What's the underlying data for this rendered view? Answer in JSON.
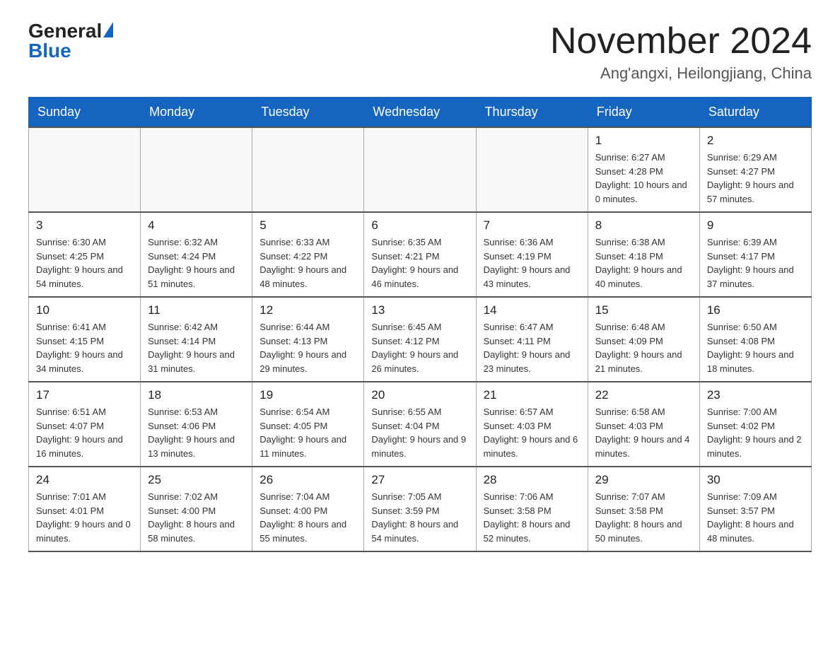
{
  "logo": {
    "general": "General",
    "blue": "Blue"
  },
  "title": "November 2024",
  "location": "Ang'angxi, Heilongjiang, China",
  "days_header": [
    "Sunday",
    "Monday",
    "Tuesday",
    "Wednesday",
    "Thursday",
    "Friday",
    "Saturday"
  ],
  "weeks": [
    [
      {
        "day": "",
        "info": ""
      },
      {
        "day": "",
        "info": ""
      },
      {
        "day": "",
        "info": ""
      },
      {
        "day": "",
        "info": ""
      },
      {
        "day": "",
        "info": ""
      },
      {
        "day": "1",
        "info": "Sunrise: 6:27 AM\nSunset: 4:28 PM\nDaylight: 10 hours and 0 minutes."
      },
      {
        "day": "2",
        "info": "Sunrise: 6:29 AM\nSunset: 4:27 PM\nDaylight: 9 hours and 57 minutes."
      }
    ],
    [
      {
        "day": "3",
        "info": "Sunrise: 6:30 AM\nSunset: 4:25 PM\nDaylight: 9 hours and 54 minutes."
      },
      {
        "day": "4",
        "info": "Sunrise: 6:32 AM\nSunset: 4:24 PM\nDaylight: 9 hours and 51 minutes."
      },
      {
        "day": "5",
        "info": "Sunrise: 6:33 AM\nSunset: 4:22 PM\nDaylight: 9 hours and 48 minutes."
      },
      {
        "day": "6",
        "info": "Sunrise: 6:35 AM\nSunset: 4:21 PM\nDaylight: 9 hours and 46 minutes."
      },
      {
        "day": "7",
        "info": "Sunrise: 6:36 AM\nSunset: 4:19 PM\nDaylight: 9 hours and 43 minutes."
      },
      {
        "day": "8",
        "info": "Sunrise: 6:38 AM\nSunset: 4:18 PM\nDaylight: 9 hours and 40 minutes."
      },
      {
        "day": "9",
        "info": "Sunrise: 6:39 AM\nSunset: 4:17 PM\nDaylight: 9 hours and 37 minutes."
      }
    ],
    [
      {
        "day": "10",
        "info": "Sunrise: 6:41 AM\nSunset: 4:15 PM\nDaylight: 9 hours and 34 minutes."
      },
      {
        "day": "11",
        "info": "Sunrise: 6:42 AM\nSunset: 4:14 PM\nDaylight: 9 hours and 31 minutes."
      },
      {
        "day": "12",
        "info": "Sunrise: 6:44 AM\nSunset: 4:13 PM\nDaylight: 9 hours and 29 minutes."
      },
      {
        "day": "13",
        "info": "Sunrise: 6:45 AM\nSunset: 4:12 PM\nDaylight: 9 hours and 26 minutes."
      },
      {
        "day": "14",
        "info": "Sunrise: 6:47 AM\nSunset: 4:11 PM\nDaylight: 9 hours and 23 minutes."
      },
      {
        "day": "15",
        "info": "Sunrise: 6:48 AM\nSunset: 4:09 PM\nDaylight: 9 hours and 21 minutes."
      },
      {
        "day": "16",
        "info": "Sunrise: 6:50 AM\nSunset: 4:08 PM\nDaylight: 9 hours and 18 minutes."
      }
    ],
    [
      {
        "day": "17",
        "info": "Sunrise: 6:51 AM\nSunset: 4:07 PM\nDaylight: 9 hours and 16 minutes."
      },
      {
        "day": "18",
        "info": "Sunrise: 6:53 AM\nSunset: 4:06 PM\nDaylight: 9 hours and 13 minutes."
      },
      {
        "day": "19",
        "info": "Sunrise: 6:54 AM\nSunset: 4:05 PM\nDaylight: 9 hours and 11 minutes."
      },
      {
        "day": "20",
        "info": "Sunrise: 6:55 AM\nSunset: 4:04 PM\nDaylight: 9 hours and 9 minutes."
      },
      {
        "day": "21",
        "info": "Sunrise: 6:57 AM\nSunset: 4:03 PM\nDaylight: 9 hours and 6 minutes."
      },
      {
        "day": "22",
        "info": "Sunrise: 6:58 AM\nSunset: 4:03 PM\nDaylight: 9 hours and 4 minutes."
      },
      {
        "day": "23",
        "info": "Sunrise: 7:00 AM\nSunset: 4:02 PM\nDaylight: 9 hours and 2 minutes."
      }
    ],
    [
      {
        "day": "24",
        "info": "Sunrise: 7:01 AM\nSunset: 4:01 PM\nDaylight: 9 hours and 0 minutes."
      },
      {
        "day": "25",
        "info": "Sunrise: 7:02 AM\nSunset: 4:00 PM\nDaylight: 8 hours and 58 minutes."
      },
      {
        "day": "26",
        "info": "Sunrise: 7:04 AM\nSunset: 4:00 PM\nDaylight: 8 hours and 55 minutes."
      },
      {
        "day": "27",
        "info": "Sunrise: 7:05 AM\nSunset: 3:59 PM\nDaylight: 8 hours and 54 minutes."
      },
      {
        "day": "28",
        "info": "Sunrise: 7:06 AM\nSunset: 3:58 PM\nDaylight: 8 hours and 52 minutes."
      },
      {
        "day": "29",
        "info": "Sunrise: 7:07 AM\nSunset: 3:58 PM\nDaylight: 8 hours and 50 minutes."
      },
      {
        "day": "30",
        "info": "Sunrise: 7:09 AM\nSunset: 3:57 PM\nDaylight: 8 hours and 48 minutes."
      }
    ]
  ]
}
